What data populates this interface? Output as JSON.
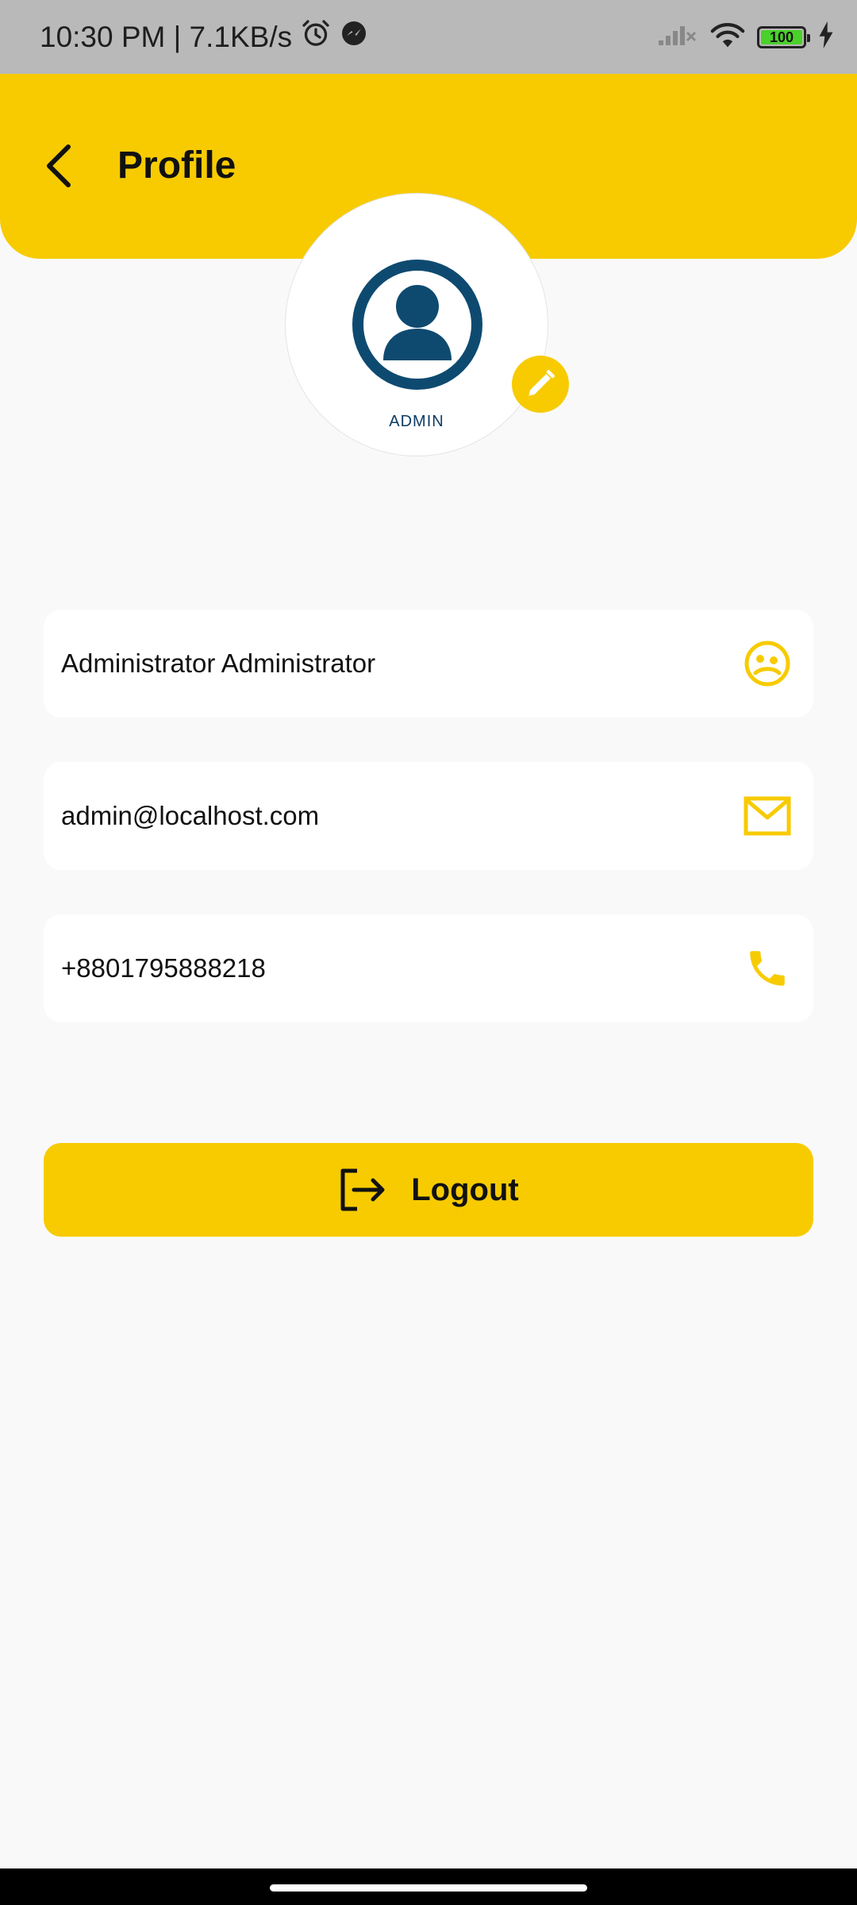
{
  "status_bar": {
    "time_speed": "10:30 PM | 7.1KB/s",
    "battery_level": "100",
    "icons": [
      "alarm-icon",
      "messenger-icon",
      "signal-icon",
      "wifi-icon",
      "battery-icon",
      "charging-icon"
    ]
  },
  "header": {
    "title": "Profile",
    "back_icon": "chevron-left-icon"
  },
  "avatar": {
    "label": "ADMIN",
    "edit_icon": "pencil-icon"
  },
  "fields": [
    {
      "value": "Administrator Administrator",
      "icon": "face-icon"
    },
    {
      "value": "admin@localhost.com",
      "icon": "mail-icon"
    },
    {
      "value": "+8801795888218",
      "icon": "phone-icon"
    }
  ],
  "logout": {
    "label": "Logout",
    "icon": "logout-icon"
  },
  "colors": {
    "accent": "#f7cb00",
    "avatar_blue": "#0e4a70",
    "background": "#f9f9f9",
    "status_bar": "#b9b9b9"
  }
}
